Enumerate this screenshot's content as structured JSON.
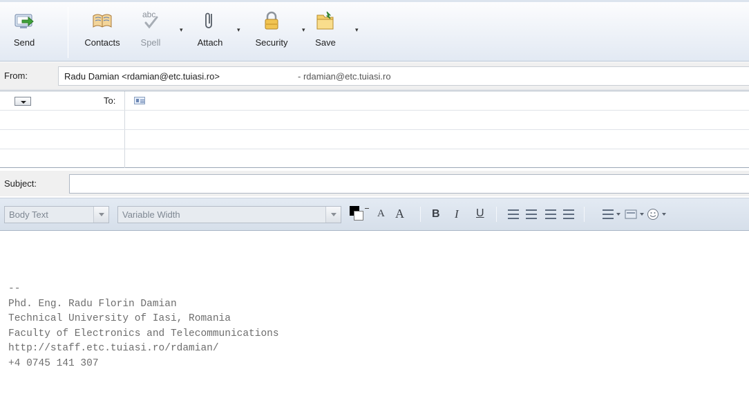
{
  "toolbar": {
    "send": "Send",
    "contacts": "Contacts",
    "spell": "Spell",
    "attach": "Attach",
    "security": "Security",
    "save": "Save",
    "spell_icon_text": "abc"
  },
  "header": {
    "from_label": "From:",
    "from_name": "Radu Damian <rdamian@etc.tuiasi.ro>",
    "from_identity": "- rdamian@etc.tuiasi.ro",
    "to_label": "To:",
    "subject_label": "Subject:",
    "subject_value": ""
  },
  "format": {
    "paragraph_style": "Body Text",
    "font": "Variable Width",
    "bold": "B",
    "italic": "I",
    "underline": "U",
    "smaller": "A",
    "larger": "A"
  },
  "body": {
    "signature": "--\nPhd. Eng. Radu Florin Damian\nTechnical University of Iasi, Romania\nFaculty of Electronics and Telecommunications\nhttp://staff.etc.tuiasi.ro/rdamian/\n+4 0745 141 307"
  },
  "colors": {
    "text_color": "#000000",
    "background_color": "#ffffff"
  }
}
